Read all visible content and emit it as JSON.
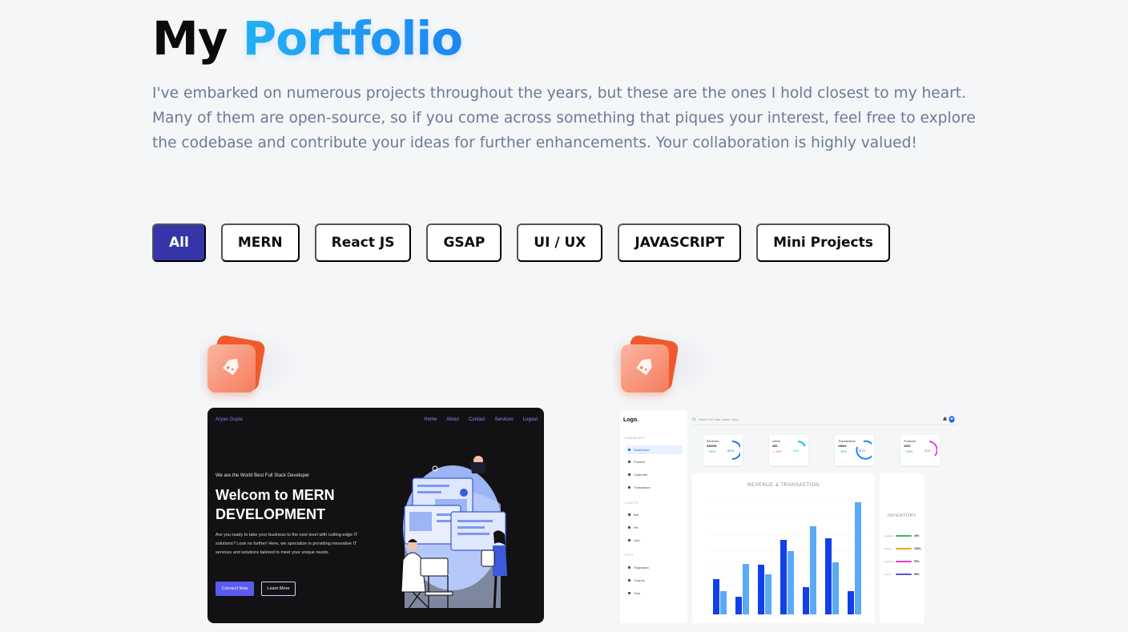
{
  "heading": {
    "prefix": "My",
    "accent": "Portfolio"
  },
  "description": "I've embarked on numerous projects throughout the years, but these are the ones I hold closest to my heart. Many of them are open-source, so if you come across something that piques your interest, feel free to explore the codebase and contribute your ideas for further enhancements. Your collaboration is highly valued!",
  "filters": [
    "All",
    "MERN",
    "React JS",
    "GSAP",
    "UI / UX",
    "JAVASCRIPT",
    "Mini Projects"
  ],
  "active_filter": "All",
  "colors": {
    "accent_blue": "#1f86f2",
    "active_filter": "#3535a8",
    "tag_orange": "#f05a2c"
  },
  "project_cards": [
    {
      "badge_icon": "tag-icon",
      "preview": {
        "brand": "Aryan Gupta",
        "nav": [
          "Home",
          "About",
          "Contact",
          "Services",
          "Logout"
        ],
        "subtitle": "We are the World Best Full Stack Developer",
        "headline_line1": "Welcom to MERN",
        "headline_line2": "DEVELOPMENT",
        "body": "Are you ready to take your business to the next level with cutting-edge IT solutions? Look no further! Here, we specialize in providing innovative IT services and solutions tailored to meet your unique needs.",
        "primary_button": "Connect Now",
        "secondary_button": "Learn More"
      }
    },
    {
      "badge_icon": "tag-icon",
      "preview": {
        "logo": "Logo.",
        "section_dashboard": "DASHBOARD",
        "section_charts": "CHARTS",
        "section_apps": "APPS",
        "menu_dashboard": [
          "Dashboard",
          "Product",
          "Customer",
          "Transaction"
        ],
        "menu_charts": [
          "Bar",
          "Pie",
          "Line"
        ],
        "menu_apps": [
          "Stopwatch",
          "Coupon",
          "Toss"
        ],
        "search_placeholder": "Search for data, users, docs",
        "stats": [
          {
            "label": "Revenue",
            "value": "340000",
            "change": "↑ +80%",
            "percent": "80%",
            "color": "#1f6fe5"
          },
          {
            "label": "Users",
            "value": "400",
            "change": "↘ -14%",
            "percent": "-14%",
            "color": "#18c2d8"
          },
          {
            "label": "Transactions",
            "value": "23000",
            "change": "↑ +80%",
            "percent": "80%",
            "color": "#1f86f2"
          },
          {
            "label": "Products",
            "value": "1000",
            "change": "↑ +30%",
            "percent": "30%",
            "color": "#e63be0"
          }
        ],
        "chart_title": "REVENUE & TRANSACTION",
        "inventory_title": "INVENTORY",
        "inventory": [
          {
            "name": "Laptops",
            "percent": "40%",
            "color": "#3ab56a"
          },
          {
            "name": "Shoes",
            "percent": "100%",
            "color": "#f2a21f"
          },
          {
            "name": "Cameras",
            "percent": "80%",
            "color": "#e63bd0"
          },
          {
            "name": "Jeans",
            "percent": "85%",
            "color": "#5b4fd8"
          }
        ]
      }
    }
  ]
}
